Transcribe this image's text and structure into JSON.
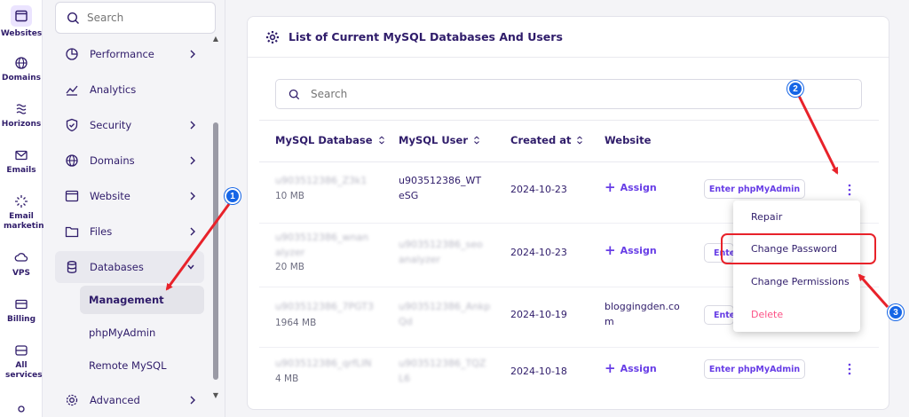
{
  "rail": {
    "items": [
      {
        "label": "Websites",
        "icon": "browser-window-icon"
      },
      {
        "label": "Domains",
        "icon": "globe-icon"
      },
      {
        "label": "Horizons",
        "icon": "horizons-icon"
      },
      {
        "label": "Emails",
        "icon": "mail-icon"
      },
      {
        "label": "Email marketing",
        "icon": "sparkle-icon"
      },
      {
        "label": "VPS",
        "icon": "cloud-server-icon"
      },
      {
        "label": "Billing",
        "icon": "credit-card-icon"
      },
      {
        "label": "All services",
        "icon": "all-services-icon"
      }
    ]
  },
  "sidebar": {
    "search_placeholder": "Search",
    "items": [
      {
        "label": "Performance",
        "icon": "gauge-icon",
        "chevron": true
      },
      {
        "label": "Analytics",
        "icon": "chart-line-icon",
        "chevron": false
      },
      {
        "label": "Security",
        "icon": "shield-icon",
        "chevron": true
      },
      {
        "label": "Domains",
        "icon": "globe-icon",
        "chevron": true
      },
      {
        "label": "Website",
        "icon": "window-icon",
        "chevron": true
      },
      {
        "label": "Files",
        "icon": "folder-icon",
        "chevron": true
      },
      {
        "label": "Databases",
        "icon": "database-icon",
        "chevron": true
      },
      {
        "label": "Advanced",
        "icon": "cog-icon",
        "chevron": true
      }
    ],
    "subitems": [
      {
        "label": "Management",
        "active": true
      },
      {
        "label": "phpMyAdmin",
        "active": false
      },
      {
        "label": "Remote MySQL",
        "active": false
      }
    ]
  },
  "card": {
    "title": "List of Current MySQL Databases And Users",
    "search_placeholder": "Search",
    "columns": [
      "MySQL Database",
      "MySQL User",
      "Created at",
      "Website"
    ],
    "rows": [
      {
        "db_name": "u903512386_Z3k1",
        "db_size": "10 MB",
        "user_line1": "u903512386_WT",
        "user_line2": "eSG",
        "created": "2024-10-23",
        "website": "Assign",
        "button": "Enter phpMyAdmin"
      },
      {
        "db_name_line1": "u903512386_wnan",
        "db_name_line2": "alyzer",
        "db_size": "20 MB",
        "user_line1": "u903512386_seo",
        "user_line2": "analyzer",
        "created": "2024-10-23",
        "website": "Assign",
        "button": "Enter phpMyAdmin"
      },
      {
        "db_name": "u903512386_7PGT3",
        "db_size": "1964 MB",
        "user_line1": "u903512386_Ankp",
        "user_line2": "Qd",
        "created": "2024-10-19",
        "website_line1": "bloggingden.co",
        "website_line2": "m",
        "button": "Enter phpMyAdmin"
      },
      {
        "db_name": "u903512386_qrfLIN",
        "db_size": "4 MB",
        "user_line1": "u903512386_TQZ",
        "user_line2": "L6",
        "created": "2024-10-18",
        "website": "Assign",
        "button": "Enter phpMyAdmin"
      }
    ],
    "menu": [
      "Repair",
      "Change Password",
      "Change Permissions",
      "Delete"
    ]
  },
  "annotations": {
    "badges": [
      "1",
      "2",
      "3"
    ],
    "arrow_color": "#e8222a",
    "badge_color": "#1565e6"
  },
  "colors": {
    "accent": "#673de6",
    "text": "#2f1c6a",
    "danger": "#fc5185"
  }
}
